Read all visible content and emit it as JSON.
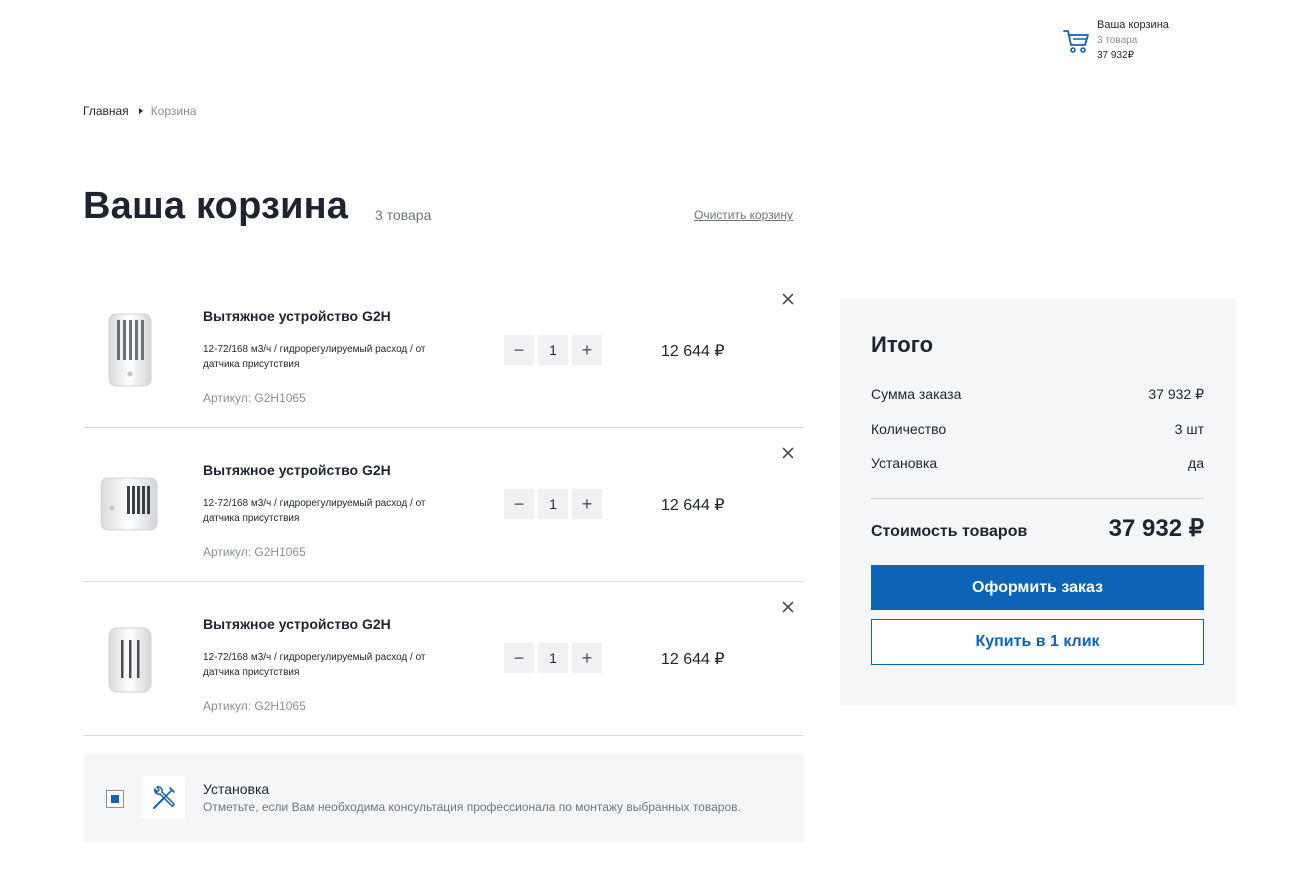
{
  "header": {
    "cart": {
      "title": "Ваша корзина",
      "count": "3 товара",
      "sum": "37 932₽",
      "icon": "shopping-cart-icon"
    }
  },
  "breadcrumb": {
    "home": "Главная",
    "current": "Корзина"
  },
  "page": {
    "title": "Ваша корзина",
    "count": "3 товара",
    "clear_label": "Очистить корзину"
  },
  "items": [
    {
      "name": "Вытяжное устройство G2H",
      "desc": "12-72/168 м3/ч / гидрорегулируемый расход / от датчика присутствия",
      "sku": "Артикул: G2H1065",
      "qty": "1",
      "price": "12 644 ₽",
      "minus": "−",
      "plus": "+"
    },
    {
      "name": "Вытяжное устройство G2H",
      "desc": "12-72/168 м3/ч / гидрорегулируемый расход / от датчика присутствия",
      "sku": "Артикул: G2H1065",
      "qty": "1",
      "price": "12 644 ₽",
      "minus": "−",
      "plus": "+"
    },
    {
      "name": "Вытяжное устройство G2H",
      "desc": "12-72/168 м3/ч / гидрорегулируемый расход / от датчика присутствия",
      "sku": "Артикул: G2H1065",
      "qty": "1",
      "price": "12 644 ₽",
      "minus": "−",
      "plus": "+"
    }
  ],
  "install": {
    "checked": true,
    "icon": "tools-icon",
    "title": "Установка",
    "desc": "Отметьте, если Вам необходима консультация профессионала по монтажу выбранных товаров."
  },
  "summary": {
    "title": "Итого",
    "rows": [
      {
        "label": "Сумма заказа",
        "value": "37 932 ₽"
      },
      {
        "label": "Количество",
        "value": "3 шт"
      },
      {
        "label": "Установка",
        "value": "да"
      }
    ],
    "total_label": "Стоимость товаров",
    "total_value": "37 932 ₽",
    "order_button": "Оформить заказ",
    "oneclick_button": "Купить в 1 клик"
  },
  "colors": {
    "accent": "#0d64b6",
    "panel_bg": "#f5f6f8",
    "text": "#1f2430",
    "muted": "#8a8f99"
  }
}
